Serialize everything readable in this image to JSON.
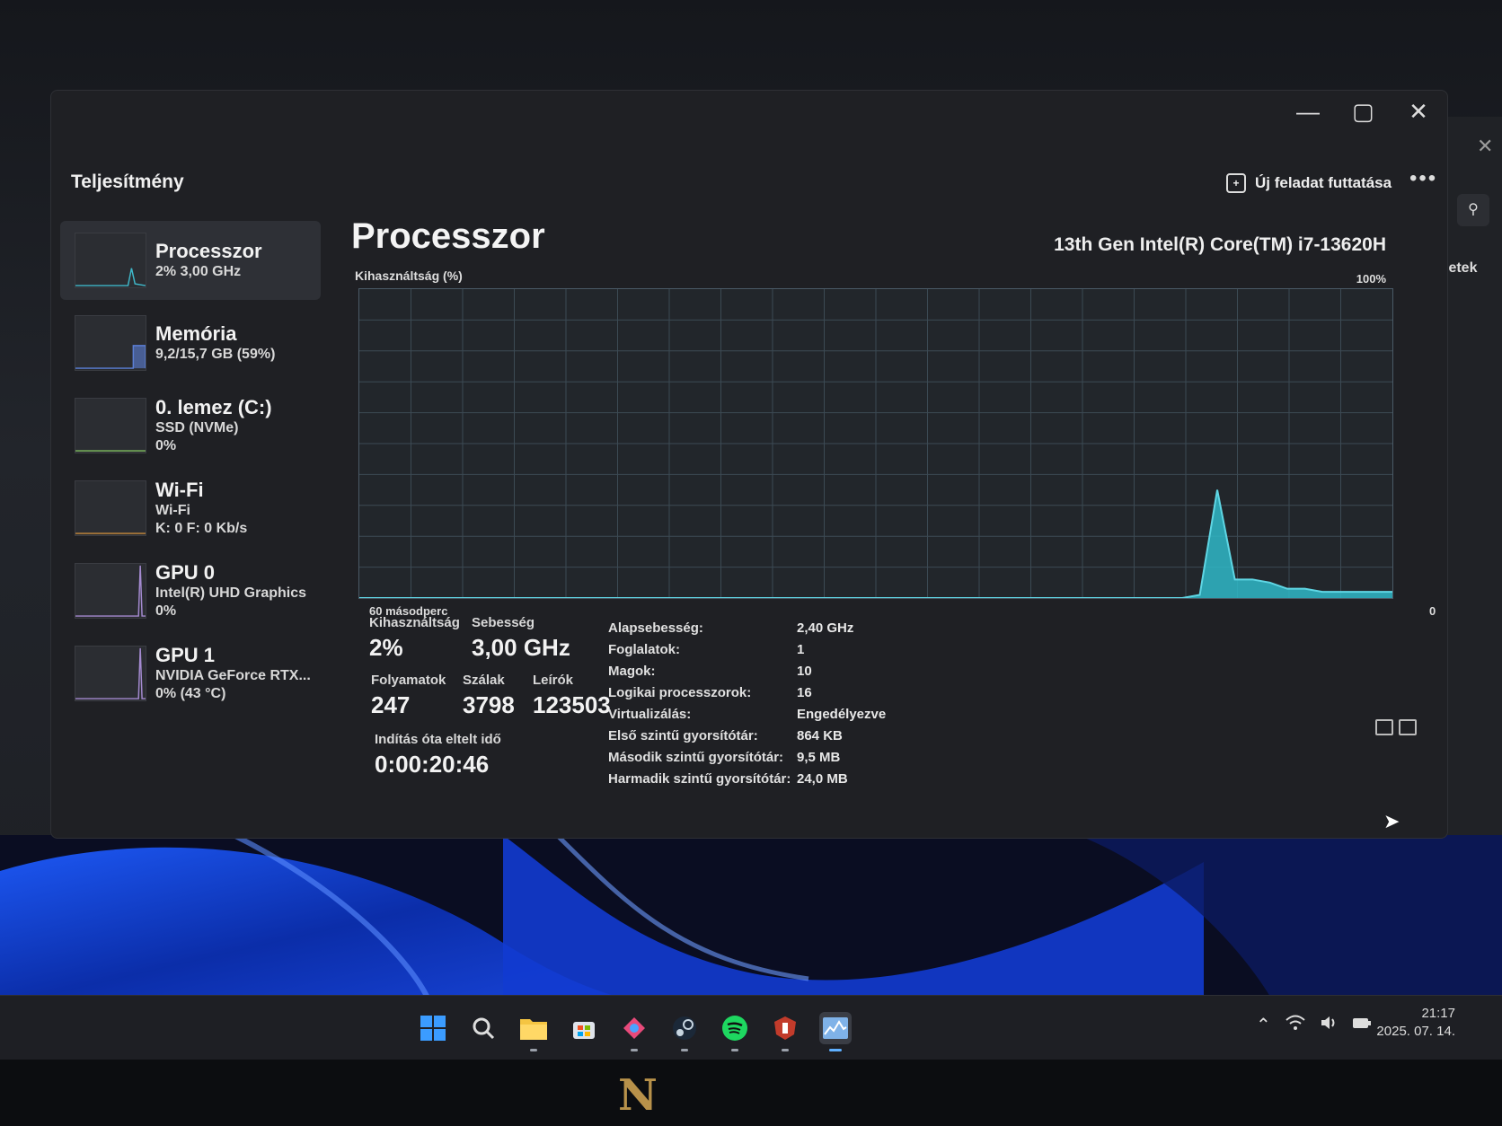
{
  "window": {
    "title": "Teljesítmény",
    "run_task": "Új feladat futtatása",
    "more": "•••",
    "controls": {
      "minimize": "—",
      "maximize": "▢",
      "close": "✕"
    }
  },
  "sidebar": {
    "items": [
      {
        "title": "Processzor",
        "lines": [
          "2% 3,00 GHz"
        ],
        "selected": true,
        "color": "#3fb7c9"
      },
      {
        "title": "Memória",
        "lines": [
          "9,2/15,7 GB (59%)"
        ],
        "color": "#5b7fd6"
      },
      {
        "title": "0. lemez (C:)",
        "lines": [
          "SSD (NVMe)",
          "0%"
        ],
        "color": "#7fbf5f"
      },
      {
        "title": "Wi-Fi",
        "lines": [
          "Wi-Fi",
          "K: 0 F: 0 Kb/s"
        ],
        "color": "#c78a3b"
      },
      {
        "title": "GPU 0",
        "lines": [
          "Intel(R) UHD Graphics",
          "0%"
        ],
        "color": "#a48ad0"
      },
      {
        "title": "GPU 1",
        "lines": [
          "NVIDIA GeForce RTX...",
          "0% (43 °C)"
        ],
        "color": "#a48ad0"
      }
    ]
  },
  "main": {
    "title": "Processzor",
    "cpu_name": "13th Gen Intel(R) Core(TM) i7-13620H",
    "graph_label": "Kihasználtság (%)",
    "graph_max": "100%",
    "graph_time": "60 másodperc",
    "graph_min": "0",
    "stats": {
      "usage_label": "Kihasználtság",
      "usage": "2%",
      "speed_label": "Sebesség",
      "speed": "3,00 GHz",
      "proc_label": "Folyamatok",
      "proc": "247",
      "threads_label": "Szálak",
      "threads": "3798",
      "handles_label": "Leírók",
      "handles": "123503",
      "uptime_label": "Indítás óta eltelt idő",
      "uptime": "0:00:20:46"
    },
    "specs": [
      {
        "k": "Alapsebesség:",
        "v": "2,40 GHz"
      },
      {
        "k": "Foglalatok:",
        "v": "1"
      },
      {
        "k": "Magok:",
        "v": "10"
      },
      {
        "k": "Logikai processzorok:",
        "v": "16"
      },
      {
        "k": "Virtualizálás:",
        "v": "Engedélyezve"
      },
      {
        "k": "Első szintű gyorsítótár:",
        "v": "864 KB"
      },
      {
        "k": "Második szintű gyorsítótár:",
        "v": "9,5 MB"
      },
      {
        "k": "Harmadik szintű gyorsítótár:",
        "v": "24,0 MB"
      }
    ]
  },
  "cpu_history_percent": [
    0,
    0,
    0,
    0,
    0,
    0,
    0,
    0,
    0,
    0,
    0,
    0,
    0,
    0,
    0,
    0,
    0,
    0,
    0,
    0,
    0,
    0,
    0,
    0,
    0,
    0,
    0,
    0,
    0,
    0,
    0,
    0,
    0,
    0,
    0,
    0,
    0,
    0,
    0,
    0,
    0,
    0,
    0,
    0,
    0,
    0,
    0,
    0,
    1,
    35,
    6,
    6,
    5,
    3,
    3,
    2,
    2,
    2,
    2,
    2
  ],
  "side_window": {
    "text": "letek"
  },
  "taskbar": {
    "clock_time": "21:17",
    "clock_date": "2025. 07. 14."
  }
}
